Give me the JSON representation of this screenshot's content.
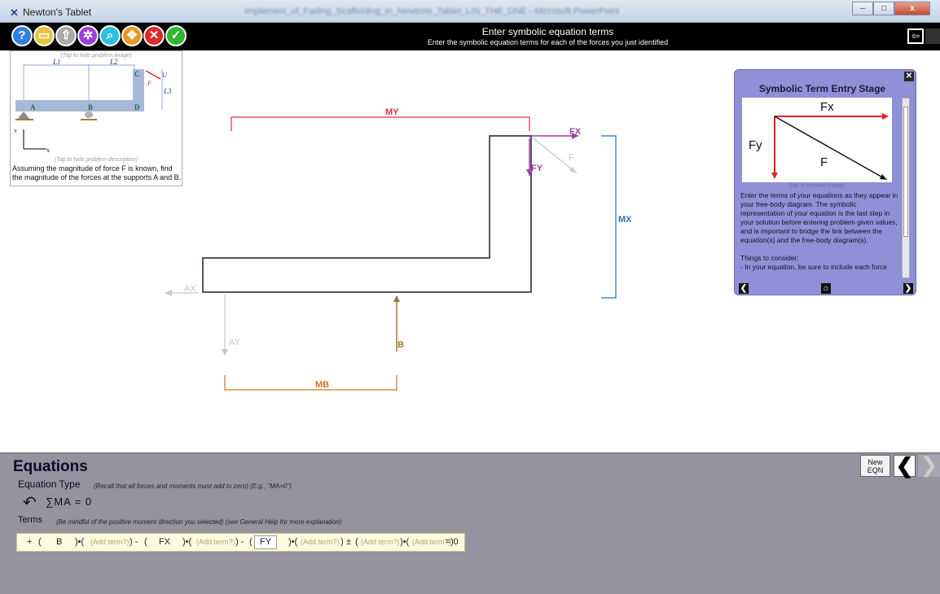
{
  "window": {
    "app_title": "Newton's Tablet",
    "doc_title": "Implement_of_Fading_Scaffolding_in_Newtons_Tablet_LIN_THE_DNE - Microsoft PowerPoint",
    "min_label": "–",
    "max_label": "□",
    "close_label": "x"
  },
  "toolbar": {
    "title": "Enter symbolic equation terms",
    "subtitle": "Enter the symbolic equation terms for each of the forces you just identified",
    "buttons": [
      {
        "icon": "help-icon",
        "glyph": "?",
        "color": "#2f7fe0"
      },
      {
        "icon": "folder-icon",
        "glyph": "▭",
        "color": "#e8c340"
      },
      {
        "icon": "upload-icon",
        "glyph": "⇧",
        "color": "#aaaaaa"
      },
      {
        "icon": "gear-icon",
        "glyph": "✲",
        "color": "#9b3fd6"
      },
      {
        "icon": "magnifier-icon",
        "glyph": "⌕",
        "color": "#2fc0e0"
      },
      {
        "icon": "move-icon",
        "glyph": "✥",
        "color": "#e89a20"
      },
      {
        "icon": "close-icon",
        "glyph": "✕",
        "color": "#e02828"
      },
      {
        "icon": "check-icon",
        "glyph": "✓",
        "color": "#2fb72f"
      }
    ],
    "back_glyph": "⇦"
  },
  "problem": {
    "image_hint": "(Tap to hide problem image)",
    "desc_hint": "(Tap to hide problem description)",
    "description": "Assuming the magnitude of force F is known, find the magnitude of the forces at the supports A and B.",
    "labels": {
      "L1": "L1",
      "L2": "L2",
      "L3": "L3",
      "A": "A",
      "B": "B",
      "C": "C",
      "D": "D",
      "F": "F",
      "U": "U",
      "y": "Y",
      "x": "X"
    }
  },
  "diagram": {
    "labels": {
      "MY": "MY",
      "FX": "FX",
      "F": "F",
      "FY": "FY",
      "MX": "MX",
      "AX": "AX",
      "AY": "AY",
      "B": "B",
      "MB": "MB"
    },
    "colors": {
      "MY": "#e0303a",
      "FX": "#a040a0",
      "MX": "#2a6fb0",
      "B": "#a07830",
      "MB": "#d07020",
      "beam": "#1a1a3a",
      "ghost": "#c8c8c8"
    }
  },
  "info": {
    "title": "Symbolic Term Entry Stage",
    "image_labels": {
      "Fx": "Fx",
      "Fy": "Fy",
      "F": "F"
    },
    "expand_hint": "(tap to expand image)",
    "text": "Enter the terms of your equations as they appear in your free-body diagram. The symbolic representation of your equation is the last step in your solution before entering problem given values, and is important to bridge the link between the equation(s) and the free-body diagram(s).",
    "text2": "Things to consider:",
    "text3": "- In your equation, be sure to include each force",
    "close_glyph": "✕",
    "prev_glyph": "❮",
    "home_glyph": "⌂",
    "next_glyph": "❯"
  },
  "equations": {
    "title": "Equations",
    "type_label": "Equation Type",
    "type_hint": "(Recall that all forces and moments must add to zero) (E.g., \"MA=0\")",
    "moment_glyph": "↶",
    "sum_text": "∑MA = 0",
    "terms_label": "Terms",
    "terms_hint": "(Be mindful of the positive moment direction you selected) (see General Help for more explanation)",
    "new_eqn": "New EQN",
    "row": {
      "t1_sign": "+",
      "t1": "B",
      "t2_sign": "-",
      "t2": "FX",
      "t3_sign": "-",
      "t3": "FY",
      "placeholder": "(Add term?)",
      "pm": "±",
      "eq": "= 0"
    },
    "prev_glyph": "❮",
    "next_glyph": "❯"
  }
}
